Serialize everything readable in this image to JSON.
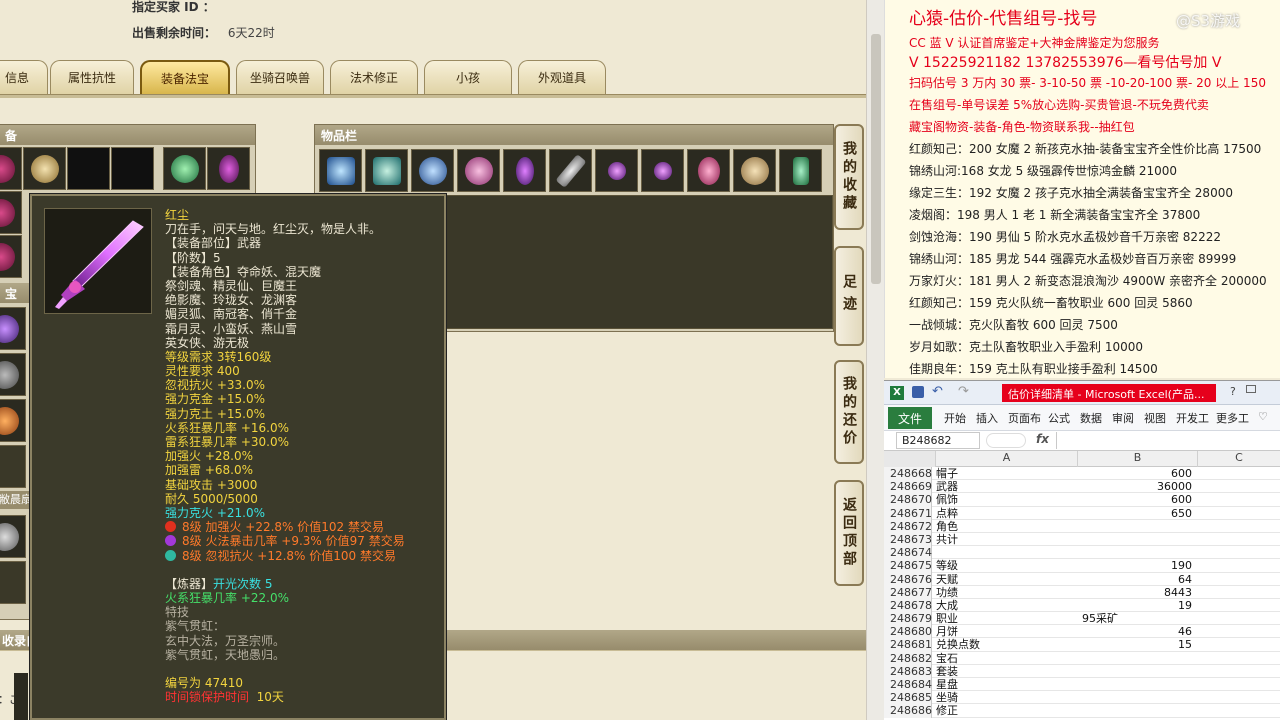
{
  "game": {
    "buyer_label": "指定买家 ID ：",
    "remaining_label": "出售剩余时间：",
    "remaining_value": "6天22时",
    "tabs": [
      "信息",
      "属性抗性",
      "装备法宝",
      "坐骑召唤兽",
      "法术修正",
      "小孩",
      "外观道具"
    ],
    "active_tab": "装备法宝",
    "equip_panel_title": "备",
    "treasure_label": "宝",
    "inventory_title": "物品栏",
    "side_buttons": [
      {
        "label": "我的收藏"
      },
      {
        "label": "足迹"
      },
      {
        "label": "我的还价"
      },
      {
        "label": "返回顶部"
      }
    ],
    "left_labels": {
      "label_a": "敝晨扇",
      "label_b": "收录自",
      "label_c": "：ご"
    }
  },
  "tooltip": {
    "name": "红尘",
    "lines": [
      {
        "text": "刀在手，问天与地。红尘灭，物是人非。",
        "color": "white"
      },
      {
        "text": "【装备部位】武器",
        "color": "white"
      },
      {
        "text": "【阶数】5",
        "color": "white"
      },
      {
        "text": "【装备角色】夺命妖、混天魔",
        "color": "white"
      },
      {
        "text": "祭剑魂、精灵仙、巨魔王",
        "color": "white"
      },
      {
        "text": "绝影魔、玲珑女、龙渊客",
        "color": "white"
      },
      {
        "text": "媚灵狐、南冠客、俏千金",
        "color": "white"
      },
      {
        "text": "霜月灵、小蛮妖、燕山雪",
        "color": "white"
      },
      {
        "text": "英女侠、游无极",
        "color": "white"
      },
      {
        "text": "等级需求 3转160级",
        "color": "gold"
      },
      {
        "text": "灵性要求 400",
        "color": "gold"
      },
      {
        "text": "忽视抗火 +33.0%",
        "color": "gold"
      },
      {
        "text": "强力克金 +15.0%",
        "color": "gold"
      },
      {
        "text": "强力克土 +15.0%",
        "color": "gold"
      },
      {
        "text": "火系狂暴几率 +16.0%",
        "color": "gold"
      },
      {
        "text": "雷系狂暴几率 +30.0%",
        "color": "gold"
      },
      {
        "text": "加强火 +28.0%",
        "color": "gold"
      },
      {
        "text": "加强雷 +68.0%",
        "color": "gold"
      },
      {
        "text": "基础攻击 +3000",
        "color": "gold"
      },
      {
        "text": "耐久 5000/5000",
        "color": "gold"
      },
      {
        "text": "强力克火 +21.0%",
        "color": "cyan"
      }
    ],
    "gems": [
      {
        "text": "8级 加强火 +22.8% 价值102 禁交易",
        "dot": "#e0301e"
      },
      {
        "text": "8级 火法暴击几率 +9.3% 价值97 禁交易",
        "dot": "#a238d8"
      },
      {
        "text": "8级 忽视抗火 +12.8% 价值100 禁交易",
        "dot": "#2fb8a0"
      }
    ],
    "refine_label": "【炼器】",
    "refine_value": "开光次数 5",
    "refine_effect": "火系狂暴几率 +22.0%",
    "special_label": "特技",
    "special_name": "紫气贯虹：",
    "special_desc1": "玄中大法，万圣宗师。",
    "special_desc2": "紫气贯虹，天地愚归。",
    "serial": "编号为 47410",
    "protect_label": "时间锁保护时间",
    "protect_value": "10天"
  },
  "ads": {
    "headline": "心猿-估价-代售组号-找号",
    "lines": [
      {
        "text": "CC 蓝 V 认证首席鉴定+大神金牌鉴定为您服务",
        "style": "red"
      },
      {
        "text": "V 15225921182      13782553976—看号估号加 V",
        "style": "phone"
      },
      {
        "text": "扫码估号 3 万内 30 票- 3-10-50 票  -10-20-100 票- 20 以上 150",
        "style": "red"
      },
      {
        "text": "在售组号-单号误差 5%放心选购-买贵管退-不玩免费代卖",
        "style": "red"
      },
      {
        "text": "藏宝阁物资-装备-角色-物资联系我--抽红包",
        "style": "red"
      },
      {
        "text": "红颜知己：200 女魔 2 新孩克水抽-装备宝宝齐全性价比高 17500",
        "style": ""
      },
      {
        "text": "锦绣山河:168 女龙 5 级强霹传世惊鸿金麟 21000",
        "style": ""
      },
      {
        "text": "缘定三生：192 女魔 2 孩子克水抽全满装备宝宝齐全 28000",
        "style": ""
      },
      {
        "text": "凌烟阁：198 男人 1 老 1 新全满装备宝宝齐全 37800",
        "style": ""
      },
      {
        "text": "剑蚀沧海：190 男仙 5 阶水克水孟极妙音千万亲密 82222",
        "style": ""
      },
      {
        "text": "锦绣山河：185 男龙 544 强霹克水孟极妙音百万亲密 89999",
        "style": ""
      },
      {
        "text": "万家灯火：181 男人 2 新变态混浪淘沙 4900W 亲密齐全 200000",
        "style": ""
      },
      {
        "text": "红颜知己：159 克火队统一畜牧职业 600 回灵 5860",
        "style": ""
      },
      {
        "text": "一战倾城：克火队畜牧 600 回灵 7500",
        "style": ""
      },
      {
        "text": "岁月如歌：克土队畜牧职业入手盈利 10000",
        "style": ""
      },
      {
        "text": "佳期良年：159 克土队有职业接手盈利 14500",
        "style": ""
      }
    ],
    "watermark": "@S3游戏"
  },
  "excel": {
    "title": "估价详细清单 - Microsoft Excel(产品...",
    "file_tab": "文件",
    "ribbon_tabs": [
      "开始",
      "插入",
      "页面布",
      "公式",
      "数据",
      "审阅",
      "视图",
      "开发工",
      "更多工"
    ],
    "name_box": "B248682",
    "fx": "fx",
    "columns": [
      "A",
      "B",
      "C"
    ],
    "rows": [
      {
        "n": "248668",
        "a": "帽子",
        "b": "600",
        "b_align": "right"
      },
      {
        "n": "248669",
        "a": "武器",
        "b": "36000",
        "b_align": "right"
      },
      {
        "n": "248670",
        "a": "佩饰",
        "b": "600",
        "b_align": "right"
      },
      {
        "n": "248671",
        "a": "点粹",
        "b": "650",
        "b_align": "right"
      },
      {
        "n": "248672",
        "a": "角色",
        "b": "",
        "b_align": "right"
      },
      {
        "n": "248673",
        "a": "共计",
        "b": "",
        "b_align": "right"
      },
      {
        "n": "248674",
        "a": "",
        "b": "",
        "b_align": "right"
      },
      {
        "n": "248675",
        "a": "等级",
        "b": "190",
        "b_align": "right"
      },
      {
        "n": "248676",
        "a": "天赋",
        "b": "64",
        "b_align": "right"
      },
      {
        "n": "248677",
        "a": "功绩",
        "b": "8443",
        "b_align": "right"
      },
      {
        "n": "248678",
        "a": "大成",
        "b": "19",
        "b_align": "right"
      },
      {
        "n": "248679",
        "a": "职业",
        "b": "95采矿",
        "b_align": "left"
      },
      {
        "n": "248680",
        "a": "月饼",
        "b": "46",
        "b_align": "right"
      },
      {
        "n": "248681",
        "a": "兑换点数",
        "b": "15",
        "b_align": "right"
      },
      {
        "n": "248682",
        "a": "宝石",
        "b": "",
        "b_align": "right"
      },
      {
        "n": "248683",
        "a": "套装",
        "b": "",
        "b_align": "right"
      },
      {
        "n": "248684",
        "a": "星盘",
        "b": "",
        "b_align": "right"
      },
      {
        "n": "248685",
        "a": "坐骑",
        "b": "",
        "b_align": "right"
      },
      {
        "n": "248686",
        "a": "修正",
        "b": "",
        "b_align": "right"
      }
    ]
  }
}
